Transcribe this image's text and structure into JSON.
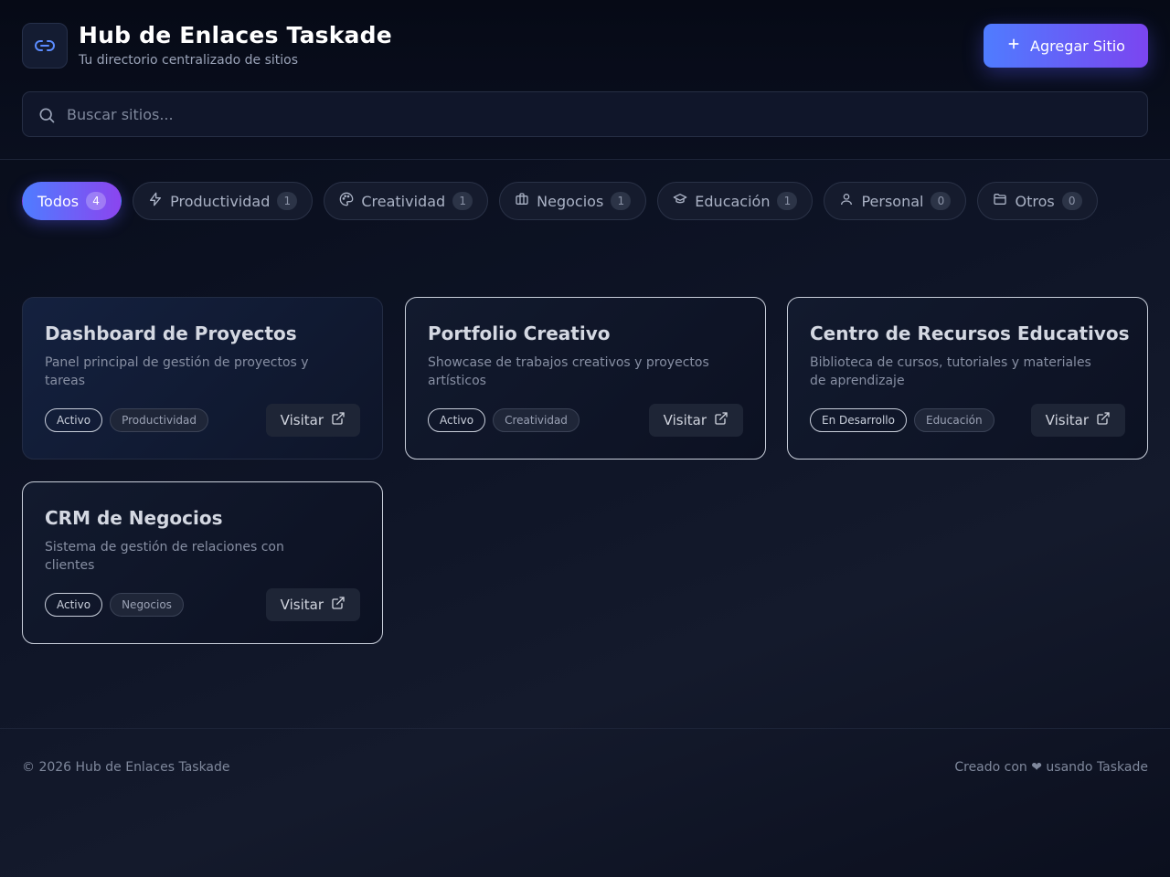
{
  "header": {
    "title": "Hub de Enlaces Taskade",
    "subtitle": "Tu directorio centralizado de sitios",
    "add_button": "Agregar Sitio",
    "logo_icon": "link-icon"
  },
  "search": {
    "placeholder": "Buscar sitios...",
    "value": ""
  },
  "filters": [
    {
      "label": "Todos",
      "count": "4",
      "icon": "none",
      "active": true
    },
    {
      "label": "Productividad",
      "count": "1",
      "icon": "lightning-icon"
    },
    {
      "label": "Creatividad",
      "count": "1",
      "icon": "palette-icon"
    },
    {
      "label": "Negocios",
      "count": "1",
      "icon": "briefcase-icon"
    },
    {
      "label": "Educación",
      "count": "1",
      "icon": "graduation-cap-icon"
    },
    {
      "label": "Personal",
      "count": "0",
      "icon": "user-icon"
    },
    {
      "label": "Otros",
      "count": "0",
      "icon": "folder-icon"
    }
  ],
  "cards": [
    {
      "title": "Dashboard de Proyectos",
      "description": "Panel principal de gestión de proyectos y tareas",
      "status": "Activo",
      "category": "Productividad",
      "visit": "Visitar"
    },
    {
      "title": "Portfolio Creativo",
      "description": "Showcase de trabajos creativos y proyectos artísticos",
      "status": "Activo",
      "category": "Creatividad",
      "visit": "Visitar"
    },
    {
      "title": "Centro de Recursos Educativos",
      "description": "Biblioteca de cursos, tutoriales y materiales de aprendizaje",
      "status": "En Desarrollo",
      "category": "Educación",
      "visit": "Visitar"
    },
    {
      "title": "CRM de Negocios",
      "description": "Sistema de gestión de relaciones con clientes",
      "status": "Activo",
      "category": "Negocios",
      "visit": "Visitar"
    }
  ],
  "footer": {
    "copyright": "© 2026 Hub de Enlaces Taskade",
    "credit": "Creado con ❤ usando Taskade"
  },
  "colors": {
    "accent_start": "#4f7cff",
    "accent_end": "#8b45ef",
    "background": "#0e1426"
  }
}
